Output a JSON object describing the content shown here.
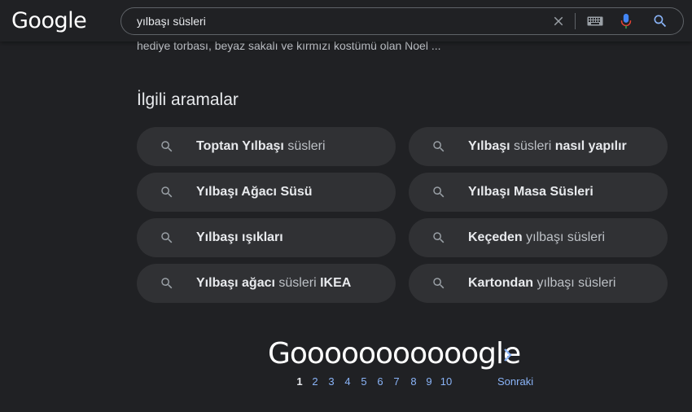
{
  "header": {
    "logo": "Google",
    "search_value": "yılbaşı süsleri"
  },
  "snippet": "hediye torbası, beyaz sakalı ve kırmızı kostümü olan Noel ...",
  "related": {
    "title": "İlgili aramalar",
    "chips": [
      {
        "bold1": "Toptan Yılbaşı",
        "plain1": " süsleri",
        "bold2": "",
        "plain2": ""
      },
      {
        "bold1": "Yılbaşı",
        "plain1": " süsleri ",
        "bold2": "nasıl yapılır",
        "plain2": ""
      },
      {
        "bold1": "Yılbaşı Ağacı Süsü",
        "plain1": "",
        "bold2": "",
        "plain2": ""
      },
      {
        "bold1": "Yılbaşı Masa Süsleri",
        "plain1": "",
        "bold2": "",
        "plain2": ""
      },
      {
        "bold1": "Yılbaşı ışıkları",
        "plain1": "",
        "bold2": "",
        "plain2": ""
      },
      {
        "bold1": "Keçeden",
        "plain1": " yılbaşı süsleri",
        "bold2": "",
        "plain2": ""
      },
      {
        "bold1": "Yılbaşı ağacı",
        "plain1": " süsleri ",
        "bold2": "IKEA",
        "plain2": ""
      },
      {
        "bold1": "Kartondan",
        "plain1": " yılbaşı süsleri",
        "bold2": "",
        "plain2": ""
      }
    ]
  },
  "pagination": {
    "logo": "Gooooooooooogle",
    "pages": [
      "1",
      "2",
      "3",
      "4",
      "5",
      "6",
      "7",
      "8",
      "9",
      "10"
    ],
    "current_page": "1",
    "next_label": "Sonraki"
  },
  "icons": {
    "clear": "close-icon",
    "keyboard": "keyboard-icon",
    "mic": "mic-icon",
    "search": "search-icon"
  },
  "colors": {
    "background": "#202124",
    "chip_bg": "#303134",
    "link": "#8ab4f8",
    "text": "#bdc1c6"
  }
}
